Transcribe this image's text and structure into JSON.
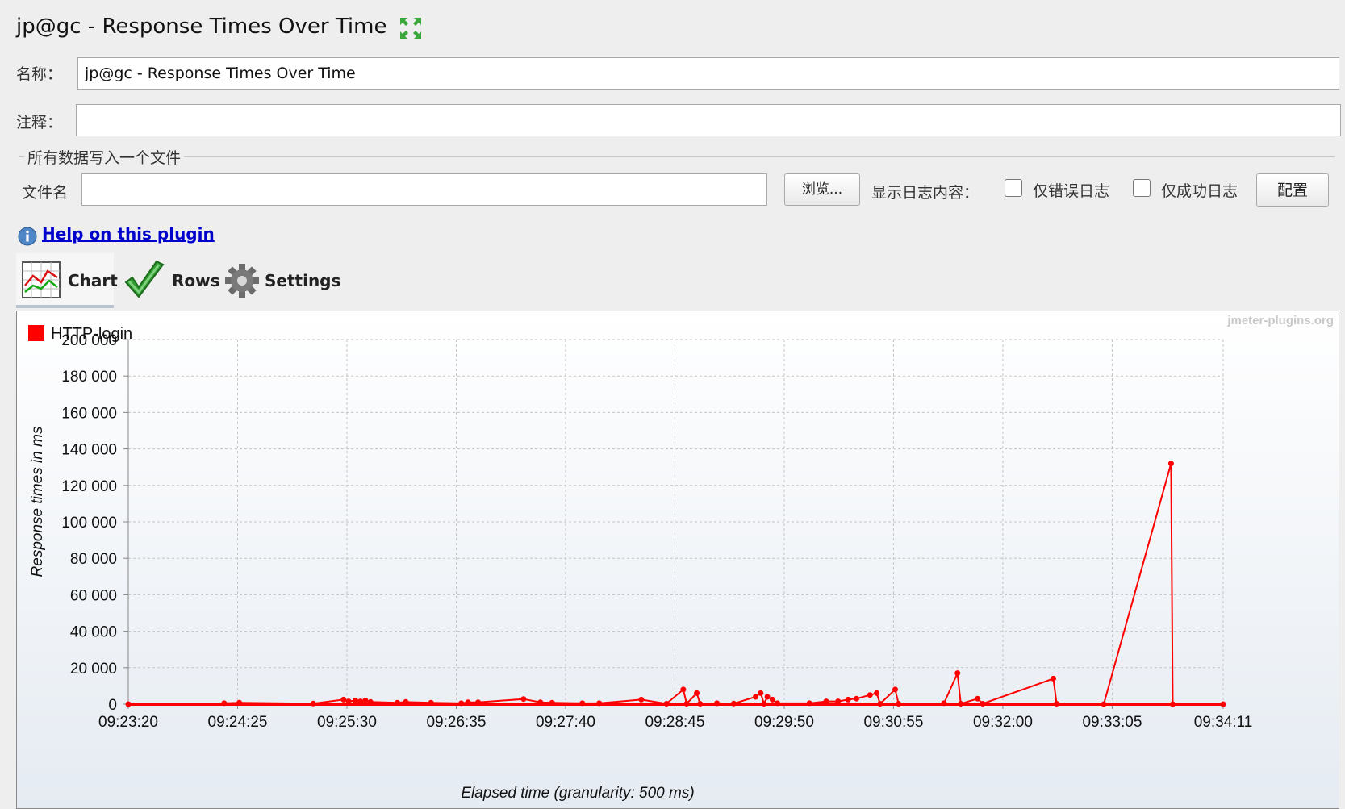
{
  "window_title": "jp@gc - Response Times Over Time",
  "form": {
    "name_label": "名称：",
    "name_value": "jp@gc - Response Times Over Time",
    "comment_label": "注释：",
    "comment_value": ""
  },
  "file_group": {
    "title": "所有数据写入一个文件",
    "filename_label": "文件名",
    "filename_value": "",
    "browse_label": "浏览...",
    "log_content_label": "显示日志内容：",
    "errors_only_label": "仅错误日志",
    "errors_only_checked": false,
    "success_only_label": "仅成功日志",
    "success_only_checked": false,
    "config_label": "配置"
  },
  "help": {
    "link_text": "Help on this plugin",
    "icon": "info-icon"
  },
  "tabs": [
    {
      "label": "Chart",
      "icon": "line-chart-icon",
      "selected": true
    },
    {
      "label": "Rows",
      "icon": "checkmark-icon",
      "selected": false
    },
    {
      "label": "Settings",
      "icon": "gear-icon",
      "selected": false
    }
  ],
  "chart_watermark": "jmeter-plugins.org",
  "chart_data": {
    "type": "line",
    "title": "",
    "xlabel": "Elapsed time (granularity: 500 ms)",
    "ylabel": "Response times in ms",
    "x_tick_labels": [
      "09:23:20",
      "09:24:25",
      "09:25:30",
      "09:26:35",
      "09:27:40",
      "09:28:45",
      "09:29:50",
      "09:30:55",
      "09:32:00",
      "09:33:05",
      "09:34:11"
    ],
    "y_tick_labels": [
      "0",
      "20 000",
      "40 000",
      "60 000",
      "80 000",
      "100 000",
      "120 000",
      "140 000",
      "160 000",
      "180 000",
      "200 000"
    ],
    "xlim": [
      "09:23:20",
      "09:34:11"
    ],
    "ylim": [
      0,
      200000
    ],
    "grid": true,
    "legend_position": "top-left",
    "series": [
      {
        "name": "HTTP-login",
        "color": "#ff0000",
        "points": [
          [
            "09:23:20",
            0
          ],
          [
            "09:24:17",
            500
          ],
          [
            "09:24:26",
            800
          ],
          [
            "09:25:10",
            300
          ],
          [
            "09:25:28",
            2500
          ],
          [
            "09:25:31",
            1500
          ],
          [
            "09:25:35",
            2000
          ],
          [
            "09:25:38",
            1500
          ],
          [
            "09:25:41",
            2000
          ],
          [
            "09:25:44",
            1200
          ],
          [
            "09:26:00",
            800
          ],
          [
            "09:26:05",
            1200
          ],
          [
            "09:26:20",
            800
          ],
          [
            "09:26:38",
            500
          ],
          [
            "09:26:42",
            1000
          ],
          [
            "09:26:48",
            1000
          ],
          [
            "09:27:15",
            2800
          ],
          [
            "09:27:25",
            1000
          ],
          [
            "09:27:32",
            800
          ],
          [
            "09:27:50",
            500
          ],
          [
            "09:28:00",
            500
          ],
          [
            "09:28:25",
            2500
          ],
          [
            "09:28:40",
            200
          ],
          [
            "09:28:50",
            8000
          ],
          [
            "09:28:52",
            200
          ],
          [
            "09:28:58",
            6000
          ],
          [
            "09:29:00",
            200
          ],
          [
            "09:29:10",
            500
          ],
          [
            "09:29:20",
            300
          ],
          [
            "09:29:33",
            4000
          ],
          [
            "09:29:36",
            6000
          ],
          [
            "09:29:38",
            200
          ],
          [
            "09:29:40",
            4000
          ],
          [
            "09:29:43",
            2500
          ],
          [
            "09:29:46",
            500
          ],
          [
            "09:30:05",
            500
          ],
          [
            "09:30:15",
            1500
          ],
          [
            "09:30:22",
            1500
          ],
          [
            "09:30:28",
            2500
          ],
          [
            "09:30:33",
            3000
          ],
          [
            "09:30:41",
            5000
          ],
          [
            "09:30:45",
            6000
          ],
          [
            "09:30:47",
            200
          ],
          [
            "09:30:56",
            8000
          ],
          [
            "09:30:58",
            200
          ],
          [
            "09:31:25",
            500
          ],
          [
            "09:31:33",
            17000
          ],
          [
            "09:31:35",
            200
          ],
          [
            "09:31:45",
            3000
          ],
          [
            "09:31:48",
            200
          ],
          [
            "09:32:30",
            14000
          ],
          [
            "09:32:32",
            200
          ],
          [
            "09:33:00",
            0
          ],
          [
            "09:33:40",
            132000
          ],
          [
            "09:33:41",
            0
          ],
          [
            "09:34:11",
            0
          ]
        ]
      }
    ]
  }
}
